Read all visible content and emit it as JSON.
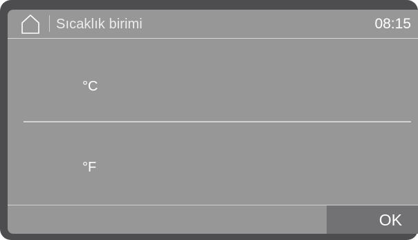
{
  "header": {
    "icon": "home-icon",
    "title": "Sıcaklık birimi",
    "time": "08:15"
  },
  "options": [
    {
      "label": "°C"
    },
    {
      "label": "°F"
    }
  ],
  "footer": {
    "ok_label": "OK"
  },
  "colors": {
    "frame": "#4d4d4f",
    "screen": "#979798",
    "ok_button": "#727274",
    "text": "#ffffff"
  }
}
